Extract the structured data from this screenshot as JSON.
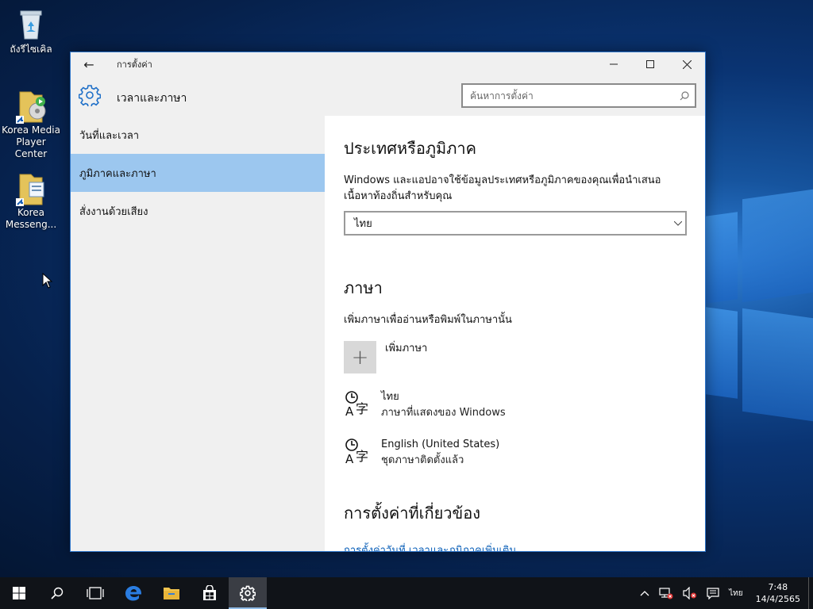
{
  "desktop": {
    "icons": [
      {
        "label": "ถังรีไซเคิล",
        "icon": "recycle-bin-icon"
      },
      {
        "label": "Korea Media Player Center",
        "icon": "media-player-shortcut-icon"
      },
      {
        "label": "Korea Messeng...",
        "icon": "messenger-shortcut-icon"
      }
    ]
  },
  "window": {
    "title": "การตั้งค่า",
    "header_title": "เวลาและภาษา",
    "search_placeholder": "ค้นหาการตั้งค่า",
    "sidebar": [
      {
        "label": "วันที่และเวลา",
        "active": false
      },
      {
        "label": "ภูมิภาคและภาษา",
        "active": true
      },
      {
        "label": "สั่งงานด้วยเสียง",
        "active": false
      }
    ],
    "region": {
      "heading": "ประเทศหรือภูมิภาค",
      "description": "Windows และแอปอาจใช้ข้อมูลประเทศหรือภูมิภาคของคุณเพื่อนำเสนอเนื้อหาท้องถิ่นสำหรับคุณ",
      "selected": "ไทย"
    },
    "language": {
      "heading": "ภาษา",
      "description": "เพิ่มภาษาเพื่ออ่านหรือพิมพ์ในภาษานั้น",
      "add_label": "เพิ่มภาษา",
      "items": [
        {
          "name": "ไทย",
          "sub": "ภาษาที่แสดงของ Windows"
        },
        {
          "name": "English (United States)",
          "sub": "ชุดภาษาติดตั้งแล้ว"
        }
      ]
    },
    "related": {
      "heading": "การตั้งค่าที่เกี่ยวข้อง",
      "link": "การตั้งค่าวันที่ เวลาและภูมิภาคเพิ่มเติม"
    }
  },
  "taskbar": {
    "input_language": "ไทย",
    "time": "7:48",
    "date": "14/4/2565"
  },
  "colors": {
    "accent": "#0a5fb8",
    "sidebar_active": "#9cc7ef",
    "chrome": "#f0f0f0",
    "taskbar": "#101318"
  }
}
